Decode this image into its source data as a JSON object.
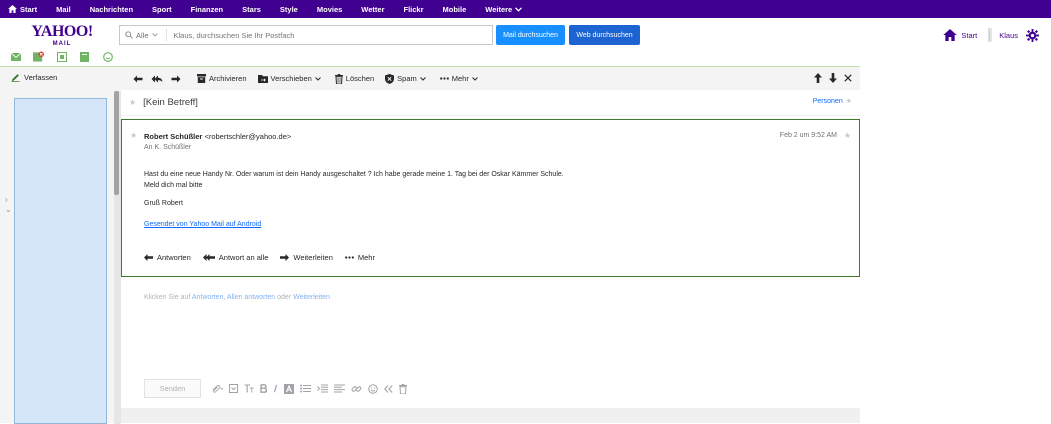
{
  "topnav": {
    "items": [
      "Start",
      "Mail",
      "Nachrichten",
      "Sport",
      "Finanzen",
      "Stars",
      "Style",
      "Movies",
      "Wetter",
      "Flickr",
      "Mobile",
      "Weitere"
    ]
  },
  "header": {
    "logo_line1": "YAHOO!",
    "logo_line2": "MAIL",
    "search_scope": "Alle",
    "search_placeholder": "Klaus, durchsuchen Sie Ihr Postfach",
    "btn_mail_search": "Mail durchsuchen",
    "btn_web_search": "Web durchsuchen",
    "right_start": "Start",
    "right_user": "Klaus"
  },
  "sidebar": {
    "compose_label": "Verfassen",
    "chevrons": [
      "›",
      "⌄"
    ]
  },
  "toolbar": {
    "archive": "Archivieren",
    "move": "Verschieben",
    "delete": "Löschen",
    "spam": "Spam",
    "more": "Mehr"
  },
  "message": {
    "subject": "[Kein Betreff]",
    "persons": "Personen",
    "sender_name": "Robert Schüßler",
    "sender_email": "<robertschler@yahoo.de>",
    "to_line": "An  K. Schüßler",
    "date": "Feb 2 um 9:52 AM",
    "body_line1": "Hast du eine neue Handy Nr. Oder warum ist dein Handy ausgeschaltet ? Ich habe gerade meine 1. Tag bei der Oskar Kämmer Schule.",
    "body_line2": "Meld dich mal bitte",
    "greeting": "Gruß Robert",
    "signature_link": "Gesendet von Yahoo Mail auf Android",
    "action_reply": "Antworten",
    "action_reply_all": "Antwort an alle",
    "action_forward": "Weiterleiten",
    "action_more": "Mehr"
  },
  "reply": {
    "hint_prefix": "Klicken Sie auf",
    "hint_reply": "Antworten",
    "hint_sep1": ",",
    "hint_reply_all": "Allen antworten",
    "hint_or": "oder",
    "hint_forward": "Weiterleiten",
    "send_button": "Senden"
  },
  "colors": {
    "brand_purple": "#400090",
    "accent_blue": "#188fff",
    "card_border": "#3f7a2c"
  }
}
